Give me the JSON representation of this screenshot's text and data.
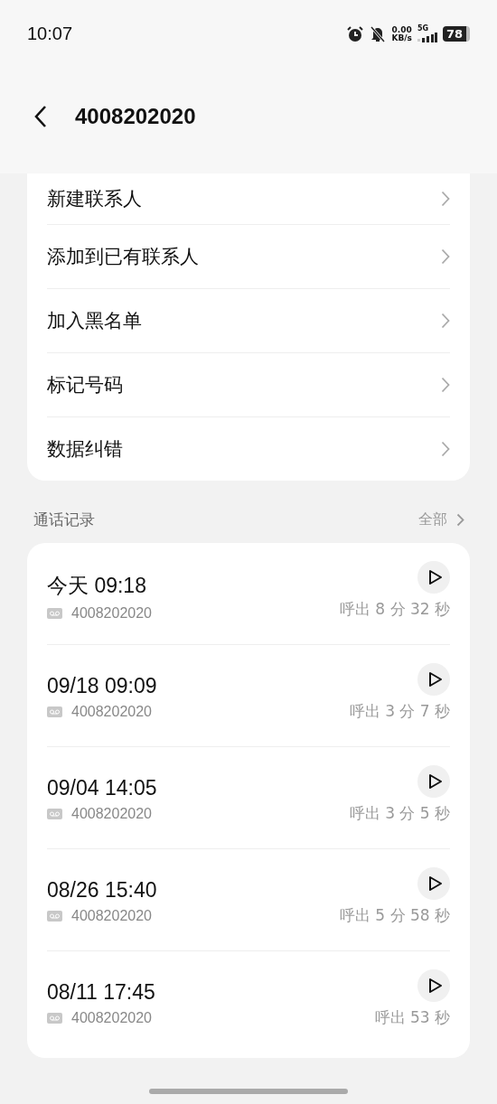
{
  "status_bar": {
    "time": "10:07",
    "net_speed": "0.00",
    "net_unit": "KB/s",
    "network": "5G",
    "battery": "78"
  },
  "header": {
    "title": "4008202020"
  },
  "menu": [
    {
      "label": "新建联系人"
    },
    {
      "label": "添加到已有联系人"
    },
    {
      "label": "加入黑名单"
    },
    {
      "label": "标记号码"
    },
    {
      "label": "数据纠错"
    }
  ],
  "call_log": {
    "title": "通话记录",
    "all_link": "全部",
    "calls": [
      {
        "time": "今天 09:18",
        "number": "4008202020",
        "detail": "呼出 8 分 32 秒"
      },
      {
        "time": "09/18 09:09",
        "number": "4008202020",
        "detail": "呼出 3 分 7 秒"
      },
      {
        "time": "09/04 14:05",
        "number": "4008202020",
        "detail": "呼出 3 分 5 秒"
      },
      {
        "time": "08/26 15:40",
        "number": "4008202020",
        "detail": "呼出 5 分 58 秒"
      },
      {
        "time": "08/11 17:45",
        "number": "4008202020",
        "detail": "呼出 53 秒"
      }
    ]
  }
}
